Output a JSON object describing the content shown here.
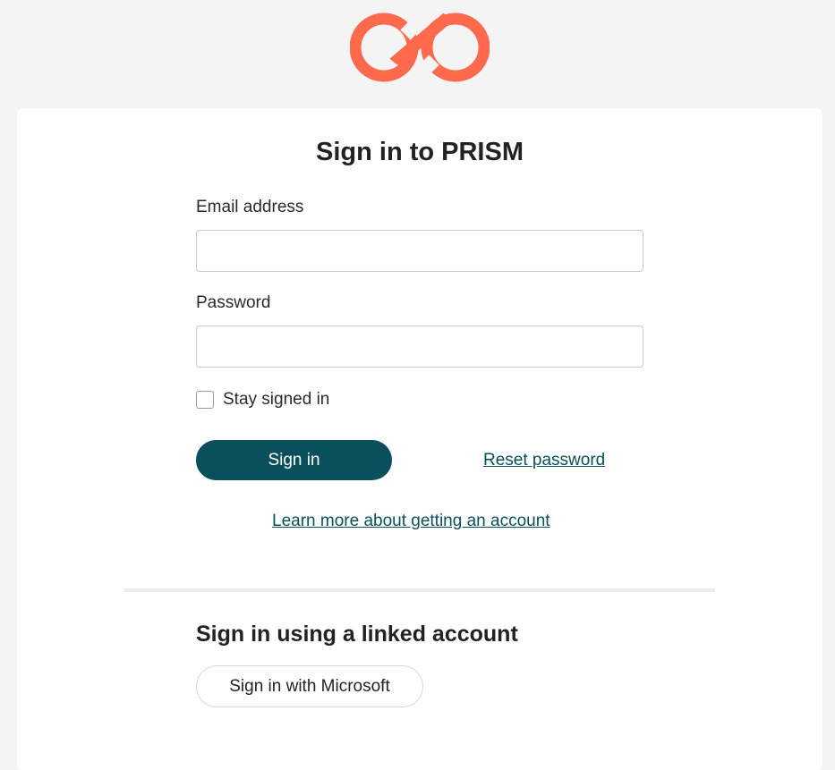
{
  "brand": {
    "logo_icon": "infinity-link-logo",
    "accent_color": "#ff6a4d"
  },
  "form": {
    "title": "Sign in to PRISM",
    "email_label": "Email address",
    "email_value": "",
    "password_label": "Password",
    "password_value": "",
    "stay_signed_in_label": "Stay signed in",
    "stay_signed_in_checked": false,
    "signin_button": "Sign in",
    "reset_password_link": "Reset password",
    "learn_more_link": "Learn more about getting an account",
    "primary_color": "#0a4f5c"
  },
  "linked": {
    "title": "Sign in using a linked account",
    "microsoft_button": "Sign in with Microsoft"
  }
}
